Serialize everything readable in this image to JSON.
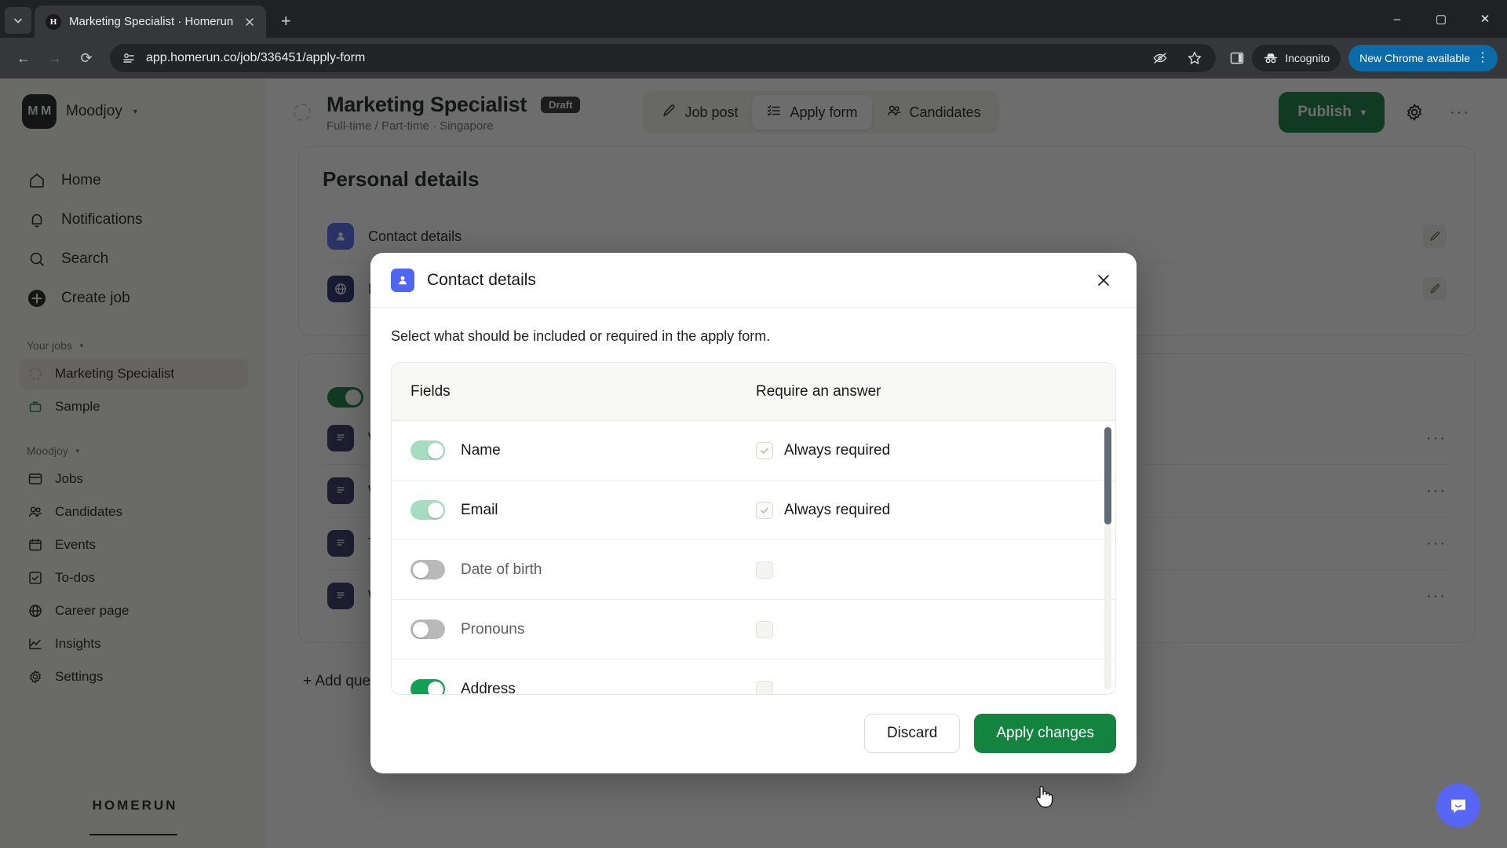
{
  "browser": {
    "tab": {
      "title": "Marketing Specialist · Homerun",
      "favicon_letter": "H",
      "close_icon": "close-icon"
    },
    "new_tab_label": "+",
    "tab_search_icon": "chevron-down-icon",
    "window_controls": {
      "minimize": "–",
      "maximize": "▢",
      "close": "✕"
    },
    "nav": {
      "back": "←",
      "forward": "→",
      "reload": "⟳"
    },
    "omnibox": {
      "url": "app.homerun.co/job/336451/apply-form",
      "site_info_icon": "page-info-icon"
    },
    "tracking_protection_icon": "eye-off-icon",
    "bookmark_icon": "star-icon",
    "side_panel_icon": "side-panel-icon",
    "incognito_label": "Incognito",
    "update_label": "New Chrome available",
    "menu_icon": "kebab-menu-icon"
  },
  "sidebar": {
    "org": {
      "initials": "M M",
      "name": "Moodjoy"
    },
    "primary": [
      {
        "label": "Home",
        "icon": "home-icon"
      },
      {
        "label": "Notifications",
        "icon": "bell-icon"
      },
      {
        "label": "Search",
        "icon": "search-icon"
      },
      {
        "label": "Create job",
        "icon": "plus-circle-icon"
      }
    ],
    "your_jobs_label": "Your jobs",
    "jobs": [
      {
        "label": "Marketing Specialist",
        "icon": "spinner-icon",
        "active": true
      },
      {
        "label": "Sample",
        "icon": "briefcase-icon",
        "active": false
      }
    ],
    "workspace_label": "Moodjoy",
    "workspace_items": [
      {
        "label": "Jobs",
        "icon": "board-icon"
      },
      {
        "label": "Candidates",
        "icon": "people-icon"
      },
      {
        "label": "Events",
        "icon": "calendar-icon"
      },
      {
        "label": "To-dos",
        "icon": "checkbox-icon"
      },
      {
        "label": "Career page",
        "icon": "globe-icon"
      },
      {
        "label": "Insights",
        "icon": "chart-line-icon"
      },
      {
        "label": "Settings",
        "icon": "gear-icon"
      }
    ],
    "logo": "HOMERUN"
  },
  "header": {
    "job_title": "Marketing Specialist",
    "badge": "Draft",
    "subtitle": "Full-time / Part-time · Singapore",
    "tabs": [
      {
        "label": "Job post",
        "icon": "pencil-icon",
        "active": false
      },
      {
        "label": "Apply form",
        "icon": "form-list-icon",
        "active": true
      },
      {
        "label": "Candidates",
        "icon": "people-icon",
        "active": false
      }
    ],
    "publish_label": "Publish",
    "publish_caret": "▾",
    "settings_icon": "gear-icon",
    "more_icon": "kebab-menu-icon"
  },
  "background_page": {
    "section_title": "Personal details",
    "fields": [
      {
        "label": "Contact details",
        "icon": "contact-card-icon",
        "color": "#4f67f0"
      },
      {
        "label": "Nationality & work permit",
        "icon": "globe-icon",
        "color": "#1e2a6b"
      }
    ],
    "question_rows": [
      {
        "label": "Why do you want to work here?",
        "icon": "question-icon"
      },
      {
        "label": "What is your experience?",
        "icon": "question-icon"
      },
      {
        "label": "Tell us about a project",
        "icon": "question-icon"
      },
      {
        "label": "When can you start?",
        "icon": "question-icon"
      }
    ],
    "add_question_label": "+ Add question",
    "edit_icon": "pencil-square-icon",
    "more_icon": "ellipsis-icon"
  },
  "modal": {
    "icon": "contact-card-icon",
    "icon_color": "#4f67f0",
    "title": "Contact details",
    "close_icon": "close-icon",
    "description": "Select what should be included or required in the apply form.",
    "columns": {
      "fields": "Fields",
      "require": "Require an answer"
    },
    "rows": [
      {
        "label": "Name",
        "toggle": "on-muted",
        "toggle_on": true,
        "require_state": "checked",
        "require_label": "Always required"
      },
      {
        "label": "Email",
        "toggle": "on-muted",
        "toggle_on": true,
        "require_state": "checked",
        "require_label": "Always required"
      },
      {
        "label": "Date of birth",
        "toggle": "off",
        "toggle_on": false,
        "require_state": "empty",
        "require_label": ""
      },
      {
        "label": "Pronouns",
        "toggle": "off",
        "toggle_on": false,
        "require_state": "empty",
        "require_label": ""
      },
      {
        "label": "Address",
        "toggle": "on-strong",
        "toggle_on": true,
        "require_state": "empty",
        "require_label": ""
      }
    ],
    "discard_label": "Discard",
    "apply_label": "Apply changes"
  },
  "intercom": {
    "icon": "chat-bubble-icon",
    "color": "#5766f5"
  },
  "colors": {
    "brand_green": "#0f7a3d",
    "apply_green": "#12843f",
    "toggle_on": "#12a153",
    "toggle_on_muted": "#a6ddc1",
    "accent_blue": "#4f67f0",
    "chrome_update_blue": "#0b6ba8"
  }
}
